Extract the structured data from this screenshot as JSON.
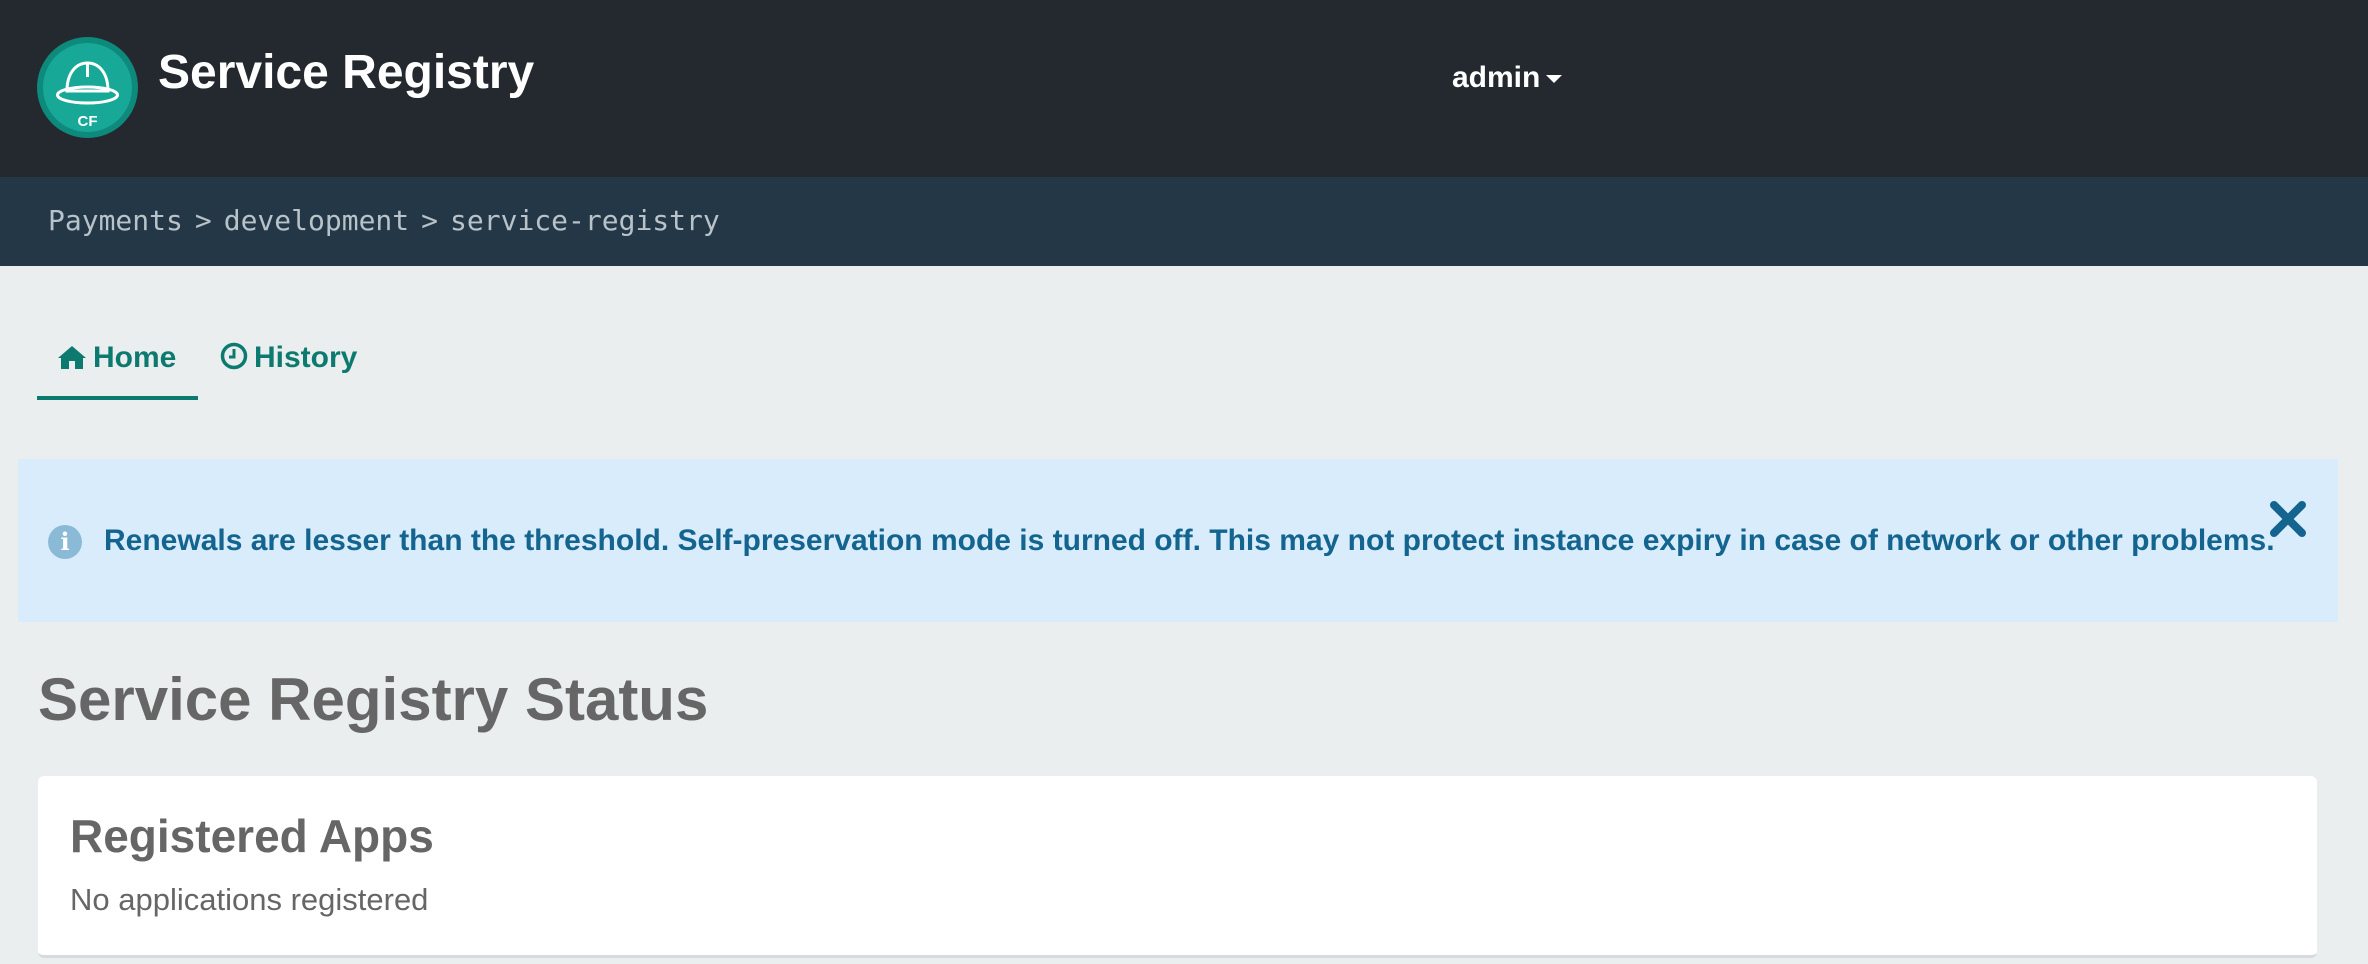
{
  "header": {
    "logo_text": "CF",
    "app_title": "Service Registry",
    "user_label": "admin"
  },
  "breadcrumb": {
    "items": [
      "Payments",
      "development",
      "service-registry"
    ],
    "separator": ">"
  },
  "tabs": [
    {
      "label": "Home",
      "icon": "home-icon",
      "active": true
    },
    {
      "label": "History",
      "icon": "clock-icon",
      "active": false
    }
  ],
  "alert": {
    "icon": "info-icon",
    "text": "Renewals are lesser than the threshold. Self-preservation mode is turned off. This may not protect instance expiry in case of network or other problems.",
    "close_icon": "close-icon"
  },
  "main": {
    "heading": "Service Registry Status",
    "registered_apps": {
      "title": "Registered Apps",
      "empty_message": "No applications registered"
    }
  },
  "colors": {
    "topbar": "#23292e",
    "breadcrumb_bar": "#243746",
    "accent": "#0d7a70",
    "alert_bg": "#d8ecfb",
    "alert_text": "#13648f"
  }
}
